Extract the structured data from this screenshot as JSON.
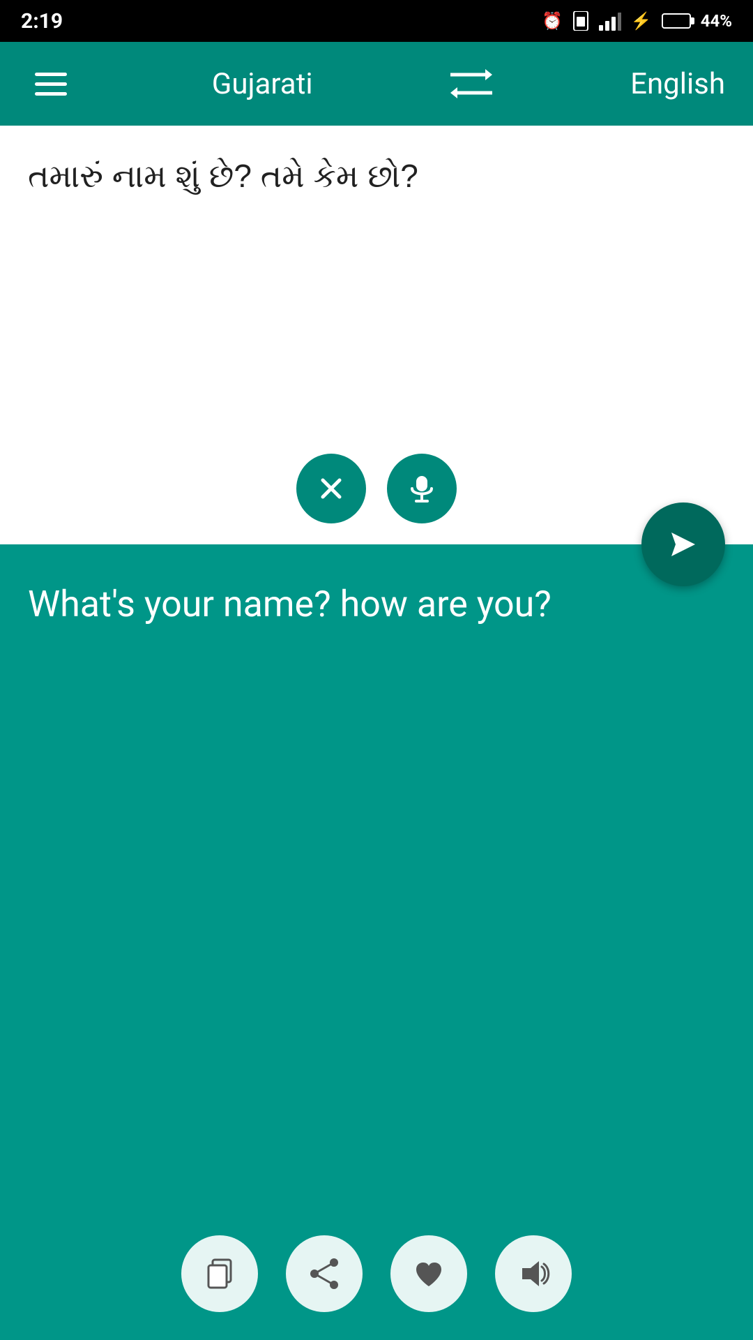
{
  "statusBar": {
    "time": "2:19",
    "batteryPercent": "44%"
  },
  "topNav": {
    "sourceLang": "Gujarati",
    "targetLang": "English",
    "menuLabel": "menu"
  },
  "inputArea": {
    "sourceText": "તમારું નામ શું છે? તમે કેમ છો?",
    "clearLabel": "clear",
    "micLabel": "microphone",
    "sendLabel": "send"
  },
  "outputArea": {
    "translatedText": "What's your name? how are you?",
    "copyLabel": "copy",
    "shareLabel": "share",
    "favoriteLabel": "favorite",
    "speakerLabel": "speaker"
  }
}
